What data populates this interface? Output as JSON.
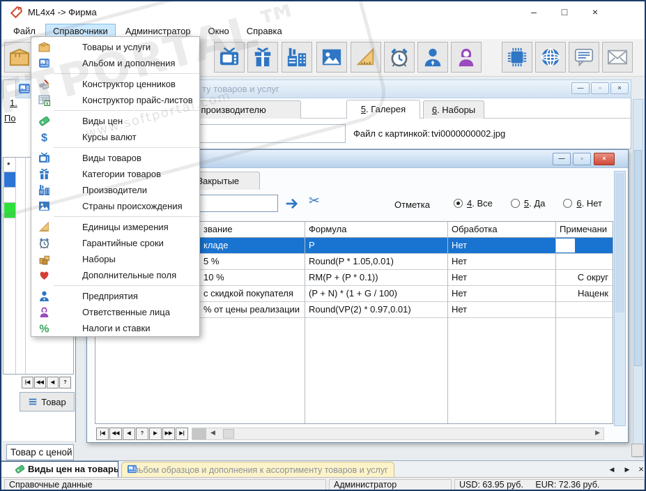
{
  "titlebar": {
    "title": "ML4x4 -> Фирма",
    "minimize": "–",
    "maximize": "□",
    "close": "×"
  },
  "menubar": {
    "active_item": "Справочники",
    "items": [
      {
        "label": "Файл",
        "name": "file"
      },
      {
        "label": "Справочники",
        "name": "references"
      },
      {
        "label": "Администратор",
        "name": "administrator"
      },
      {
        "label": "Окно",
        "name": "window"
      },
      {
        "label": "Справка",
        "name": "help"
      }
    ]
  },
  "toolbar": {
    "buttons": [
      {
        "name": "goods-and-services",
        "icon": "box"
      },
      {
        "name": "product-kinds",
        "icon": "tv"
      },
      {
        "name": "product-categories",
        "icon": "gift"
      },
      {
        "name": "manufacturers",
        "icon": "factory"
      },
      {
        "name": "countries-of-origin",
        "icon": "picture"
      },
      {
        "name": "units-of-measure",
        "icon": "ruler"
      },
      {
        "name": "warranty-periods",
        "icon": "clock"
      },
      {
        "name": "enterprises",
        "icon": "person-blue"
      },
      {
        "name": "responsible-persons",
        "icon": "person-purple"
      },
      {
        "name": "hardware",
        "icon": "chip"
      },
      {
        "name": "internet",
        "icon": "globe"
      },
      {
        "name": "messages",
        "icon": "chat"
      },
      {
        "name": "mail",
        "icon": "envelope"
      }
    ]
  },
  "dropdown": {
    "items": [
      {
        "label": "Товары и услуги",
        "icon": "box",
        "name": "goods-and-services",
        "sep": false
      },
      {
        "label": "Альбом и дополнения",
        "icon": "album",
        "name": "album-and-additions",
        "sep": true
      },
      {
        "label": "Конструктор ценников",
        "icon": "tags",
        "name": "price-tag-constructor",
        "sep": false
      },
      {
        "label": "Конструктор прайс-листов",
        "icon": "pricelist",
        "name": "price-list-constructor",
        "sep": true
      },
      {
        "label": "Виды цен",
        "icon": "tag-green",
        "name": "price-kinds",
        "sep": false
      },
      {
        "label": "Курсы валют",
        "icon": "dollar",
        "name": "currency-rates",
        "sep": true
      },
      {
        "label": "Виды товаров",
        "icon": "tv",
        "name": "product-kinds",
        "sep": false
      },
      {
        "label": "Категории товаров",
        "icon": "gift",
        "name": "product-categories",
        "sep": false
      },
      {
        "label": "Производители",
        "icon": "factory",
        "name": "manufacturers",
        "sep": false
      },
      {
        "label": "Страны происхождения",
        "icon": "picture",
        "name": "countries-of-origin",
        "sep": true
      },
      {
        "label": "Единицы измерения",
        "icon": "ruler",
        "name": "units-of-measure",
        "sep": false
      },
      {
        "label": "Гарантийные сроки",
        "icon": "clock",
        "name": "warranty-periods",
        "sep": false
      },
      {
        "label": "Наборы",
        "icon": "boxes",
        "name": "sets",
        "sep": false
      },
      {
        "label": "Дополнительные поля",
        "icon": "heart",
        "name": "additional-fields",
        "sep": true
      },
      {
        "label": "Предприятия",
        "icon": "person-blue",
        "name": "enterprises",
        "sep": false
      },
      {
        "label": "Ответственные лица",
        "icon": "person-purple",
        "name": "responsible-persons",
        "sep": false
      },
      {
        "label": "Налоги и ставки",
        "icon": "percent",
        "name": "taxes-and-rates",
        "sep": false
      }
    ]
  },
  "album_window": {
    "title_fragment": "ту товаров и услуг",
    "tab_manufacturer": "По производителю",
    "tab_gallery": "5. Галерея",
    "tab_sets": "6. Наборы",
    "file_label": "Файл с картинкой:",
    "file_value": "tvi0000000002.jpg",
    "minimize": "—",
    "restore": "▫",
    "close": "×"
  },
  "left_pane": {
    "tab": "1.",
    "link": "По",
    "grid_marker": "•",
    "nav": [
      "|◀",
      "◀◀",
      "◀",
      "?"
    ],
    "tovar_button": "Товар",
    "combo_value": "Товар с ценой"
  },
  "price_window": {
    "tab": "3. Закрытые",
    "search_value": "",
    "mark_label": "Отметка",
    "radios": [
      {
        "label": "4. Все",
        "selected": true
      },
      {
        "label": "5. Да",
        "selected": false
      },
      {
        "label": "6. Нет",
        "selected": false
      }
    ],
    "table": {
      "headers": [
        "звание",
        "Формула",
        "Обработка",
        "Примечани"
      ],
      "rows": [
        {
          "name": "кладе",
          "formula": "P",
          "processing": "Нет",
          "note": "",
          "selected": true
        },
        {
          "name": "5 %",
          "formula": "Round(P * 1.05,0.01)",
          "processing": "Нет",
          "note": "",
          "selected": false
        },
        {
          "name": "10 %",
          "formula": "RM(P + (P * 0.1))",
          "processing": "Нет",
          "note": "С округ",
          "selected": false
        },
        {
          "name": "с скидкой покупателя",
          "formula": "(P + N) * (1 + G / 100)",
          "processing": "Нет",
          "note": "Наценк",
          "selected": false
        },
        {
          "name": "% от цены реализации",
          "formula": "Round(VP(2) * 0.97,0.01)",
          "processing": "Нет",
          "note": "",
          "selected": false
        }
      ]
    },
    "nav": [
      "|◀",
      "◀◀",
      "◀",
      "?",
      "▶",
      "▶▶",
      "▶|"
    ],
    "minimize": "—",
    "restore": "▫",
    "close": "×"
  },
  "bottom_tabs": {
    "active": {
      "label": "Виды цен на товары",
      "icon": "tag-green"
    },
    "inactive": {
      "label": "Альбом образцов и дополнения к ассортименту товаров и услуг",
      "icon": "album"
    },
    "prev": "◀",
    "next": "▶",
    "close": "×"
  },
  "statusbar": {
    "section": "Справочные данные",
    "user": "Администратор",
    "usd": "USD: 63.95 руб.",
    "eur": "EUR: 72.36 руб."
  },
  "watermark": {
    "text": "FTPORTAL™",
    "subtext": "www.softportal.com"
  }
}
